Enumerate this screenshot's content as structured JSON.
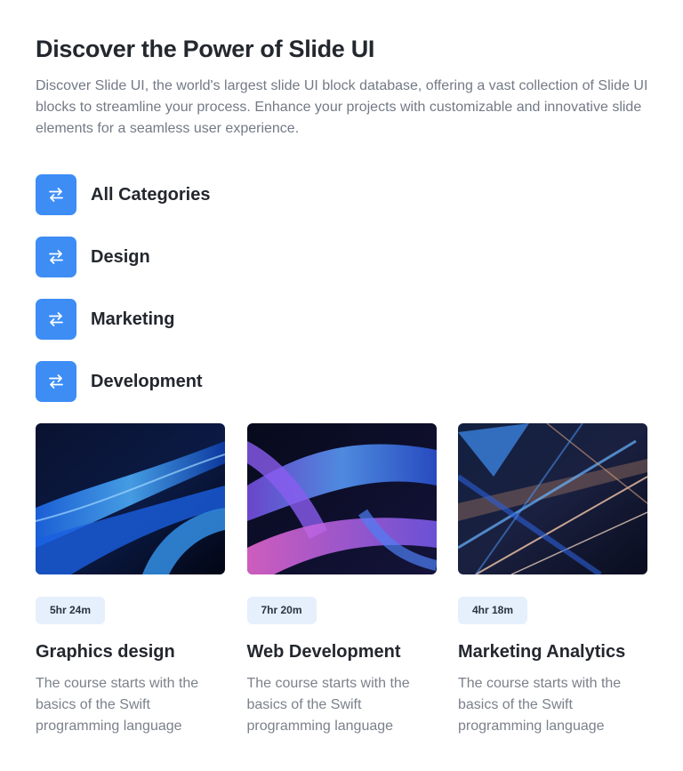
{
  "header": {
    "title": "Discover the Power of Slide UI",
    "description": "Discover Slide UI, the world's largest slide UI block database, offering a vast collection of Slide UI blocks to streamline your process. Enhance your projects with customizable and innovative slide elements for a seamless user experience."
  },
  "categories": [
    {
      "label": "All Categories",
      "icon": "arrows-left-right-icon"
    },
    {
      "label": "Design",
      "icon": "arrows-left-right-icon"
    },
    {
      "label": "Marketing",
      "icon": "arrows-left-right-icon"
    },
    {
      "label": "Development",
      "icon": "arrows-left-right-icon"
    }
  ],
  "courses": [
    {
      "duration": "5hr 24m",
      "title": "Graphics design",
      "description": "The course starts with the basics of the Swift programming language"
    },
    {
      "duration": "7hr 20m",
      "title": "Web Development",
      "description": "The course starts with the basics of the Swift programming language"
    },
    {
      "duration": "4hr 18m",
      "title": "Marketing Analytics",
      "description": "The course starts with the basics of the Swift programming language"
    }
  ],
  "colors": {
    "accent": "#3d8df5",
    "badge_bg": "#e5f0fc",
    "heading": "#23272e",
    "body_text": "#737a86"
  }
}
